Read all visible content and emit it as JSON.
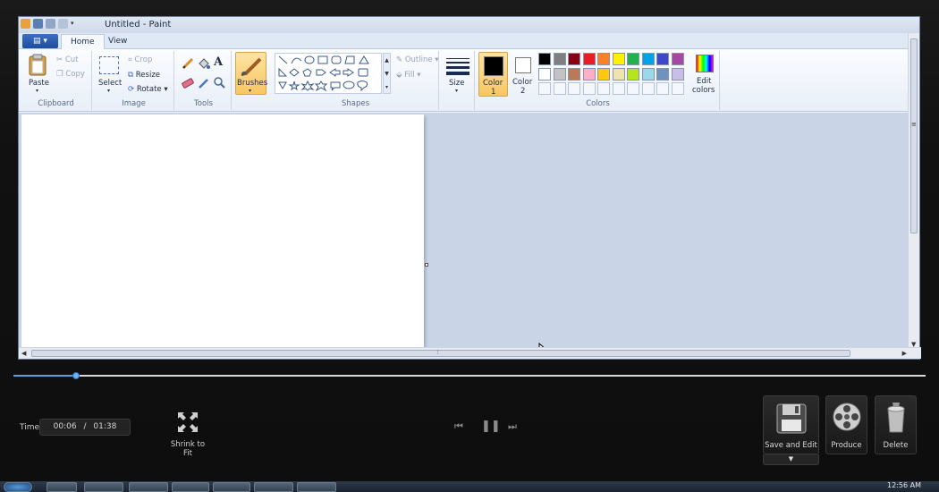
{
  "window": {
    "title": "Untitled - Paint"
  },
  "tabs": [
    {
      "label": "Home"
    },
    {
      "label": "View"
    }
  ],
  "clipboard": {
    "paste": "Paste",
    "cut": "Cut",
    "copy": "Copy",
    "label": "Clipboard"
  },
  "image": {
    "select": "Select",
    "crop": "Crop",
    "resize": "Resize",
    "rotate": "Rotate",
    "label": "Image"
  },
  "tools": {
    "label": "Tools",
    "text_tool": "A"
  },
  "brushes": {
    "label": "Brushes"
  },
  "shapes": {
    "outline": "Outline",
    "fill": "Fill",
    "label": "Shapes"
  },
  "size": {
    "label": "Size"
  },
  "colors": {
    "color1_label": "Color",
    "color1_num": "1",
    "color2_label": "Color",
    "color2_num": "2",
    "edit_label_1": "Edit",
    "edit_label_2": "colors",
    "label": "Colors",
    "color1": "#000000",
    "color2": "#ffffff",
    "palette_row1": [
      "#000000",
      "#7f7f7f",
      "#880015",
      "#ed1c24",
      "#ff7f27",
      "#fff200",
      "#22b14c",
      "#00a2e8",
      "#3f48cc",
      "#a349a4"
    ],
    "palette_row2": [
      "#ffffff",
      "#c3c3c3",
      "#b97a57",
      "#ffaec9",
      "#ffc90e",
      "#efe4b0",
      "#b5e61d",
      "#99d9ea",
      "#7092be",
      "#c8bfe7"
    ]
  },
  "player": {
    "time_label": "Time",
    "current": "00:06",
    "separator": "/",
    "total": "01:38",
    "progress": 0.069,
    "shrink_label": "Shrink to Fit",
    "save_edit_label": "Save and Edit",
    "produce_label": "Produce",
    "delete_label": "Delete"
  },
  "taskbar": {
    "clock": "12:56 AM"
  }
}
